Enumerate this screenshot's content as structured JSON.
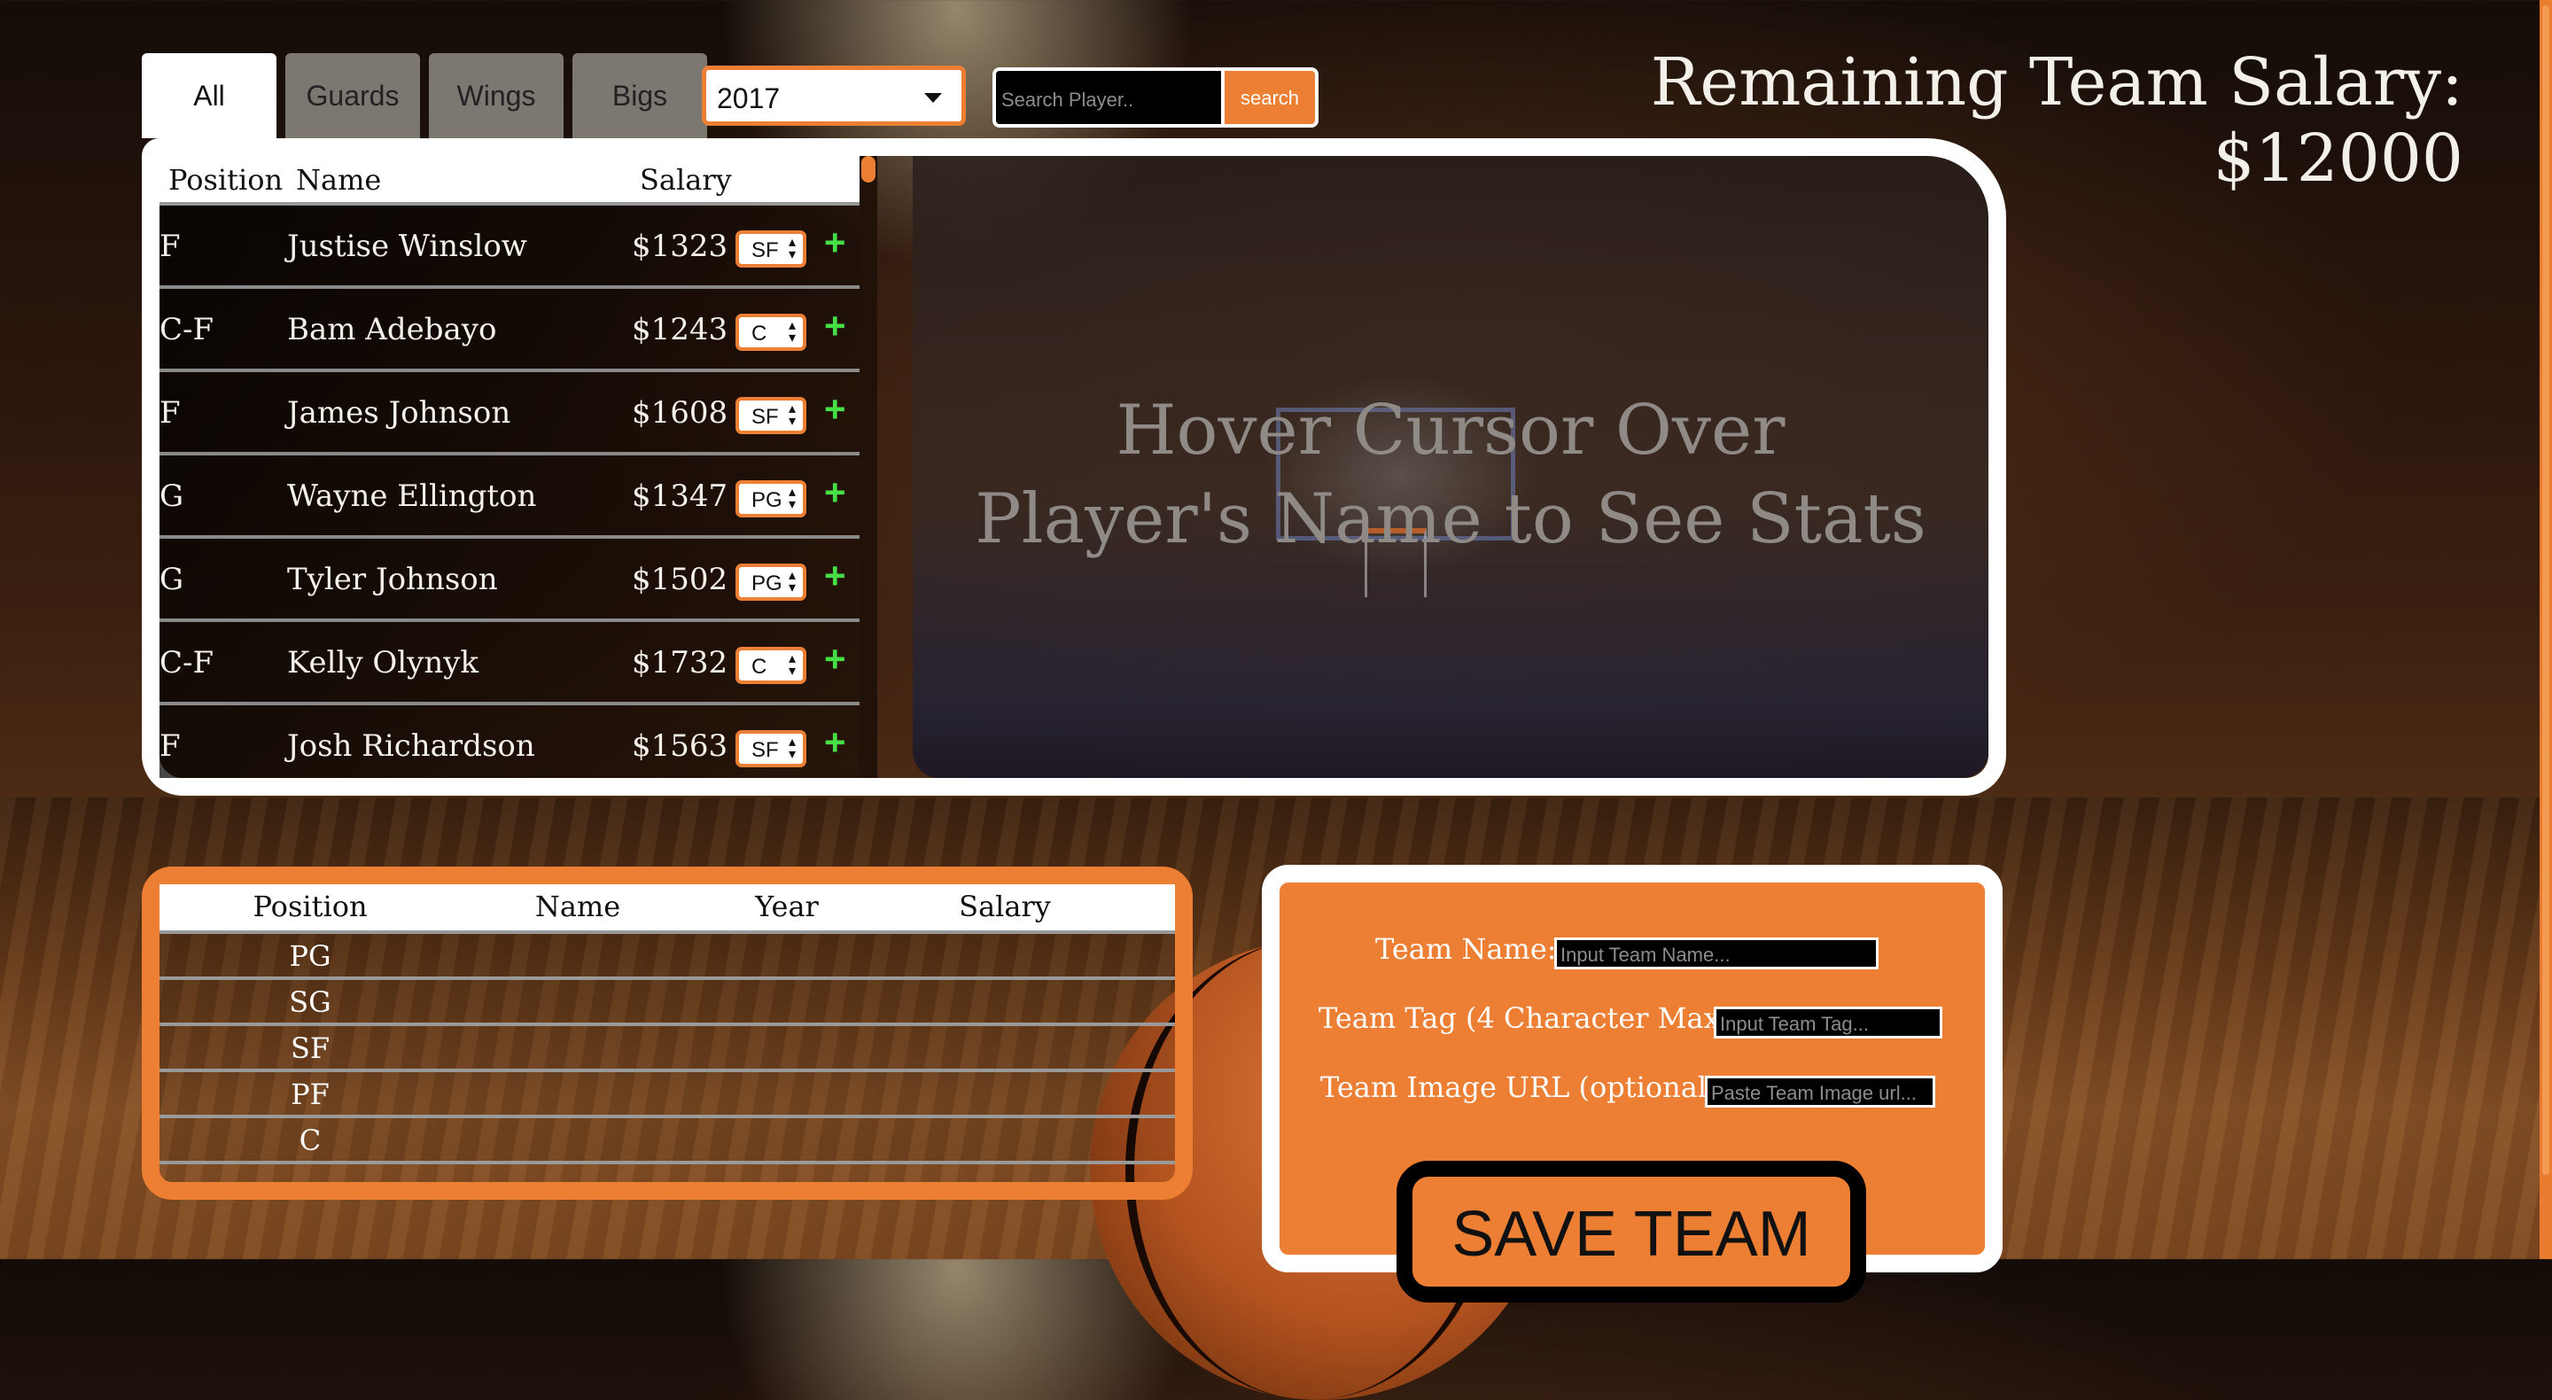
{
  "tabs": [
    {
      "label": "All",
      "active": true
    },
    {
      "label": "Guards",
      "active": false
    },
    {
      "label": "Wings",
      "active": false
    },
    {
      "label": "Bigs",
      "active": false
    }
  ],
  "year_select": {
    "value": "2017"
  },
  "search": {
    "placeholder": "Search Player..",
    "button_label": "search"
  },
  "salary_title": "Remaining Team Salary: $12000",
  "player_list": {
    "headers": {
      "position": "Position",
      "name": "Name",
      "salary": "Salary"
    },
    "rows": [
      {
        "position": "F",
        "name": "Justise Winslow",
        "salary": "$1323",
        "slot": "SF",
        "add": "+"
      },
      {
        "position": "C-F",
        "name": "Bam Adebayo",
        "salary": "$1243",
        "slot": "C",
        "add": "+"
      },
      {
        "position": "F",
        "name": "James Johnson",
        "salary": "$1608",
        "slot": "SF",
        "add": "+"
      },
      {
        "position": "G",
        "name": "Wayne Ellington",
        "salary": "$1347",
        "slot": "PG",
        "add": "+"
      },
      {
        "position": "G",
        "name": "Tyler Johnson",
        "salary": "$1502",
        "slot": "PG",
        "add": "+"
      },
      {
        "position": "C-F",
        "name": "Kelly Olynyk",
        "salary": "$1732",
        "slot": "C",
        "add": "+"
      },
      {
        "position": "F",
        "name": "Josh Richardson",
        "salary": "$1563",
        "slot": "SF",
        "add": "+"
      }
    ]
  },
  "stats_panel": {
    "line1": "Hover Cursor Over",
    "line2": "Player's Name to See Stats"
  },
  "roster": {
    "headers": {
      "position": "Position",
      "name": "Name",
      "year": "Year",
      "salary": "Salary"
    },
    "rows": [
      {
        "position": "PG"
      },
      {
        "position": "SG"
      },
      {
        "position": "SF"
      },
      {
        "position": "PF"
      },
      {
        "position": "C"
      }
    ]
  },
  "team_form": {
    "team_name_label": "Team Name:",
    "team_name_placeholder": "Input Team Name...",
    "team_tag_label": "Team Tag (4 Character Max):",
    "team_tag_placeholder": "Input Team Tag...",
    "team_image_label": "Team Image URL (optional):",
    "team_image_placeholder": "Paste Team Image url...",
    "save_label": "SAVE TEAM"
  },
  "colors": {
    "accent": "#ec7f34",
    "add_green": "#46e046"
  }
}
